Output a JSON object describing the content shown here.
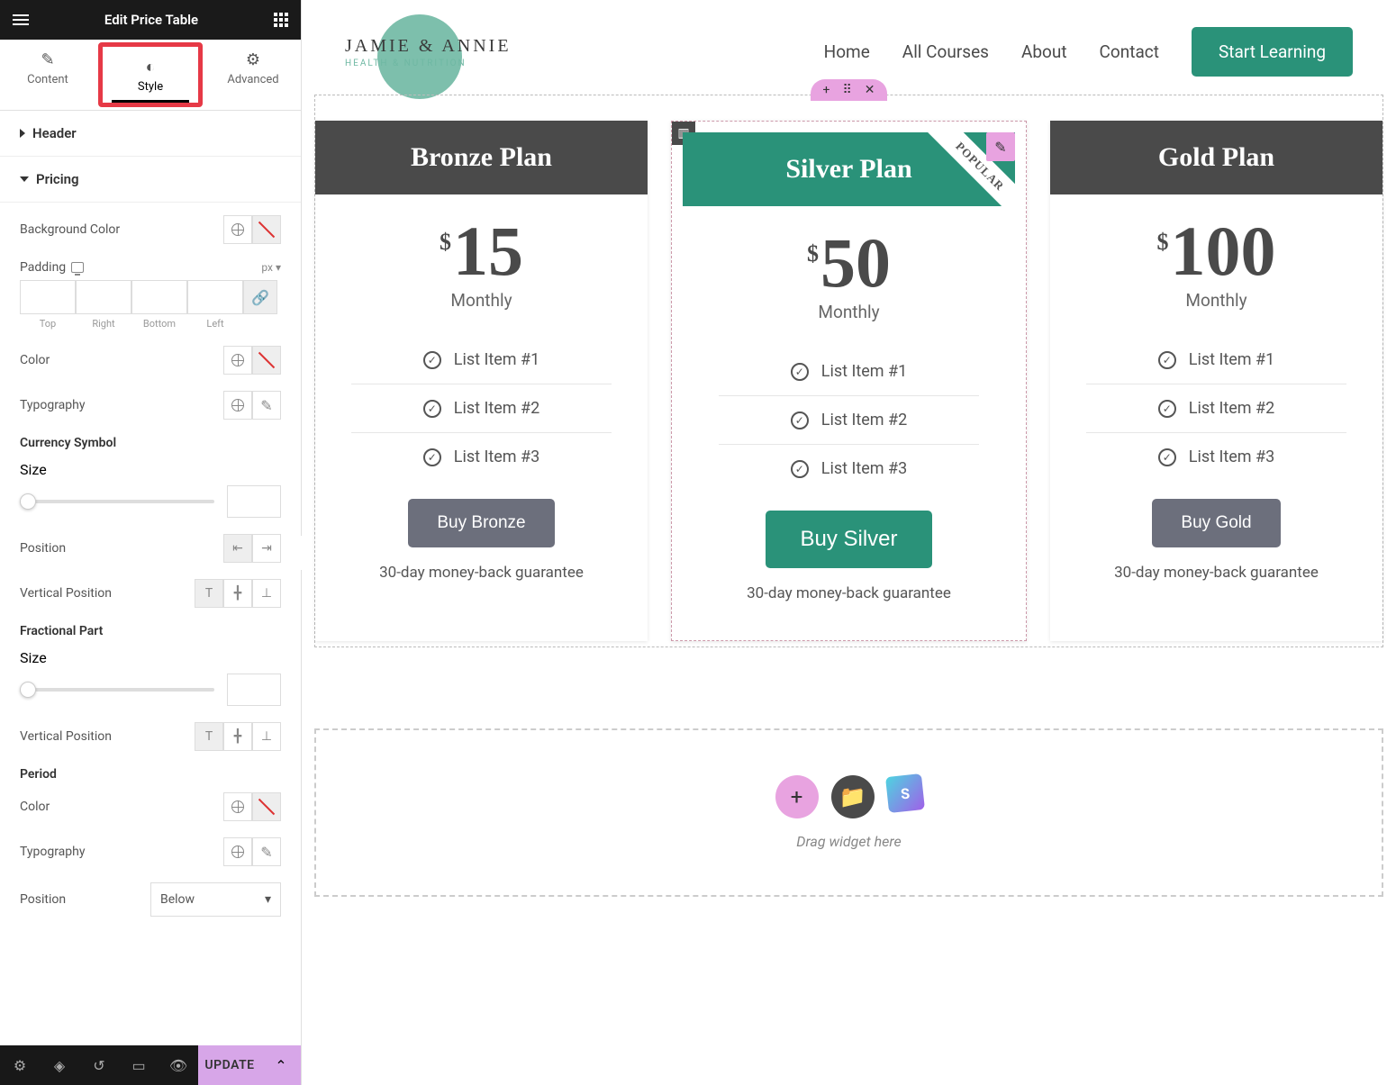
{
  "sidebar": {
    "title": "Edit Price Table",
    "tabs": {
      "content": "Content",
      "style": "Style",
      "advanced": "Advanced"
    },
    "sections": {
      "header": "Header",
      "pricing": "Pricing",
      "bg_label": "Background Color",
      "padding_label": "Padding",
      "padding_unit": "px",
      "padding_sides": {
        "top": "Top",
        "right": "Right",
        "bottom": "Bottom",
        "left": "Left"
      },
      "color_label": "Color",
      "typo_label": "Typography",
      "currency_head": "Currency Symbol",
      "size_label": "Size",
      "position_label": "Position",
      "vpos_label": "Vertical Position",
      "fractional_head": "Fractional Part",
      "period_head": "Period",
      "period_position_value": "Below"
    },
    "footer": {
      "update": "UPDATE"
    }
  },
  "site": {
    "logo_main": "JAMIE & ANNIE",
    "logo_sub": "HEALTH & NUTRITION",
    "nav": {
      "home": "Home",
      "courses": "All Courses",
      "about": "About",
      "contact": "Contact"
    },
    "cta": "Start Learning"
  },
  "plans": [
    {
      "title": "Bronze Plan",
      "currency": "$",
      "amount": "15",
      "period": "Monthly",
      "items": [
        "List Item #1",
        "List Item #2",
        "List Item #3"
      ],
      "button": "Buy Bronze",
      "guarantee": "30-day money-back guarantee"
    },
    {
      "title": "Silver Plan",
      "currency": "$",
      "amount": "50",
      "period": "Monthly",
      "ribbon": "POPULAR",
      "items": [
        "List Item #1",
        "List Item #2",
        "List Item #3"
      ],
      "button": "Buy Silver",
      "guarantee": "30-day money-back guarantee"
    },
    {
      "title": "Gold Plan",
      "currency": "$",
      "amount": "100",
      "period": "Monthly",
      "items": [
        "List Item #1",
        "List Item #2",
        "List Item #3"
      ],
      "button": "Buy Gold",
      "guarantee": "30-day money-back guarantee"
    }
  ],
  "drop": {
    "text": "Drag widget here"
  }
}
